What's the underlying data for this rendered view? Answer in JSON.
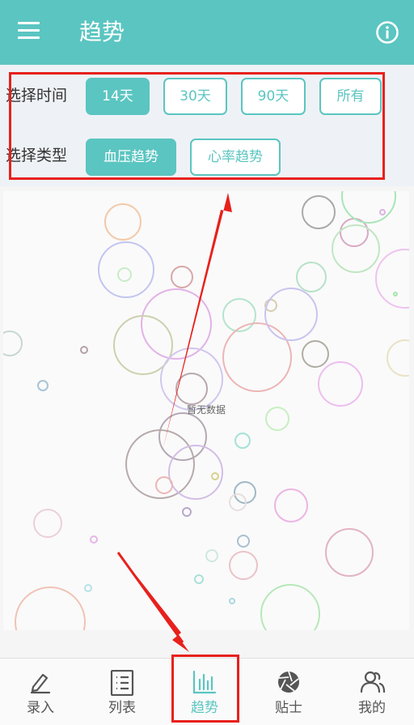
{
  "appbar": {
    "title": "趋势",
    "menu_icon": "menu-icon",
    "info_icon": "info-icon"
  },
  "filters": {
    "time_label": "选择时间",
    "time_options": [
      "14天",
      "30天",
      "90天",
      "所有"
    ],
    "time_selected": "14天",
    "type_label": "选择类型",
    "type_options": [
      "血压趋势",
      "心率趋势"
    ],
    "type_selected": "血压趋势"
  },
  "chart": {
    "empty_text": "暂无数据"
  },
  "tabs": [
    {
      "label": "录入",
      "icon": "pen-icon"
    },
    {
      "label": "列表",
      "icon": "list-icon"
    },
    {
      "label": "趋势",
      "icon": "chart-icon",
      "active": true
    },
    {
      "label": "贴士",
      "icon": "aperture-icon"
    },
    {
      "label": "我的",
      "icon": "people-icon"
    }
  ],
  "colors": {
    "accent": "#5bc5c1",
    "annotation": "#e8201c",
    "tab_inactive": "#555555"
  }
}
